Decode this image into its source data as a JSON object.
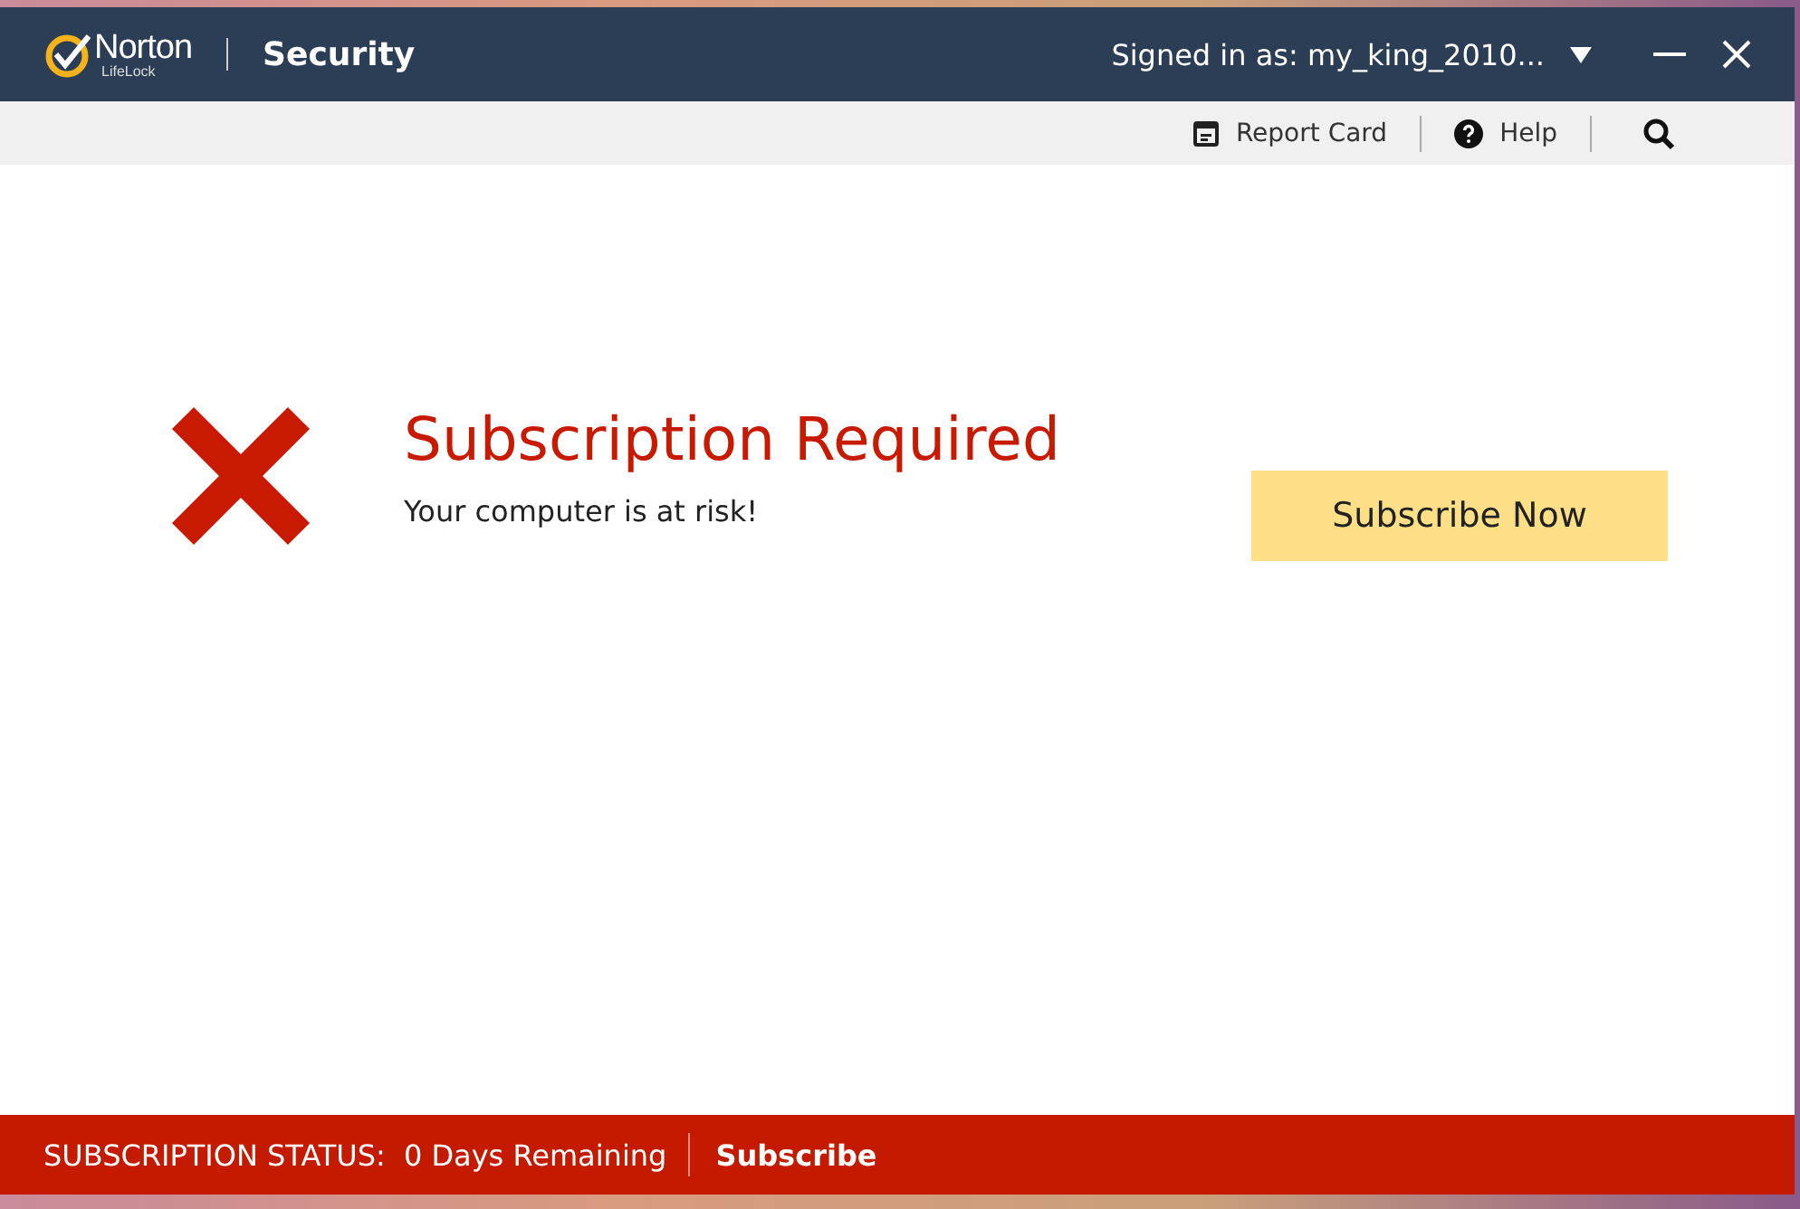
{
  "header": {
    "logo_name": "Norton",
    "logo_sub": "LifeLock",
    "product": "Security",
    "account": "Signed in as: my_king_2010..."
  },
  "toolbar": {
    "items": [
      {
        "kind": "report",
        "label": "Report Card"
      },
      {
        "kind": "help",
        "label": "Help"
      },
      {
        "kind": "search"
      }
    ]
  },
  "alert": {
    "title": "Subscription Required",
    "message": "Your computer is at risk!",
    "button": "Subscribe Now"
  },
  "status_bar": {
    "label": "SUBSCRIPTION STATUS:",
    "value": "0 Days Remaining",
    "link": "Subscribe"
  }
}
